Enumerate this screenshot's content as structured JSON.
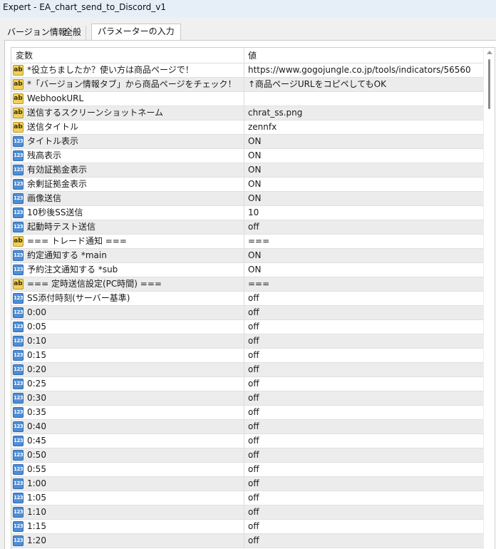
{
  "window": {
    "title": "Expert - EA_chart_send_to_Discord_v1"
  },
  "tabs": [
    {
      "label": "バージョン情報"
    },
    {
      "label": "全般"
    },
    {
      "label": "パラメーターの入力",
      "active": true
    }
  ],
  "grid": {
    "columns": {
      "name": "変数",
      "value": "値"
    },
    "rows": [
      {
        "icon": "string-icon",
        "name": "*役立ちましたか？使い方は商品ページで！",
        "value": "https://www.gogojungle.co.jp/tools/indicators/56560"
      },
      {
        "icon": "string-icon",
        "name": "*「バージョン情報タブ」から商品ページをチェック！",
        "value": "↑商品ページURLをコピペしてもOK"
      },
      {
        "icon": "string-icon",
        "name": "WebhookURL",
        "value": ""
      },
      {
        "icon": "string-icon",
        "name": "送信するスクリーンショットネーム",
        "value": "chrat_ss.png"
      },
      {
        "icon": "string-icon",
        "name": "送信タイトル",
        "value": "zennfx"
      },
      {
        "icon": "number-icon",
        "name": "タイトル表示",
        "value": "ON"
      },
      {
        "icon": "number-icon",
        "name": "残高表示",
        "value": "ON"
      },
      {
        "icon": "number-icon",
        "name": "有効証拠金表示",
        "value": "ON"
      },
      {
        "icon": "number-icon",
        "name": "余剰証拠金表示",
        "value": "ON"
      },
      {
        "icon": "number-icon",
        "name": "画像送信",
        "value": "ON"
      },
      {
        "icon": "number-icon",
        "name": "10秒後SS送信",
        "value": "10"
      },
      {
        "icon": "number-icon",
        "name": "起動時テスト送信",
        "value": "off"
      },
      {
        "icon": "string-icon",
        "name": "=== トレード通知 ===",
        "value": "==="
      },
      {
        "icon": "number-icon",
        "name": "約定通知する *main",
        "value": "ON"
      },
      {
        "icon": "number-icon",
        "name": "予約注文通知する *sub",
        "value": "ON"
      },
      {
        "icon": "string-icon",
        "name": "=== 定時送信設定(PC時間) ===",
        "value": "==="
      },
      {
        "icon": "number-icon",
        "name": "SS添付時刻(サーバー基準)",
        "value": "off"
      },
      {
        "icon": "number-icon",
        "name": "0:00",
        "value": "off"
      },
      {
        "icon": "number-icon",
        "name": "0:05",
        "value": "off"
      },
      {
        "icon": "number-icon",
        "name": "0:10",
        "value": "off"
      },
      {
        "icon": "number-icon",
        "name": "0:15",
        "value": "off"
      },
      {
        "icon": "number-icon",
        "name": "0:20",
        "value": "off"
      },
      {
        "icon": "number-icon",
        "name": "0:25",
        "value": "off"
      },
      {
        "icon": "number-icon",
        "name": "0:30",
        "value": "off"
      },
      {
        "icon": "number-icon",
        "name": "0:35",
        "value": "off"
      },
      {
        "icon": "number-icon",
        "name": "0:40",
        "value": "off"
      },
      {
        "icon": "number-icon",
        "name": "0:45",
        "value": "off"
      },
      {
        "icon": "number-icon",
        "name": "0:50",
        "value": "off"
      },
      {
        "icon": "number-icon",
        "name": "0:55",
        "value": "off"
      },
      {
        "icon": "number-icon",
        "name": "1:00",
        "value": "off"
      },
      {
        "icon": "number-icon",
        "name": "1:05",
        "value": "off"
      },
      {
        "icon": "number-icon",
        "name": "1:10",
        "value": "off"
      },
      {
        "icon": "number-icon",
        "name": "1:15",
        "value": "off"
      },
      {
        "icon": "number-icon",
        "name": "1:20",
        "value": "off"
      }
    ]
  },
  "icons": {
    "string": {
      "glyph": "ab",
      "color": "#f1d05a"
    },
    "number": {
      "glyph": "123",
      "color": "#4e8ed6"
    }
  }
}
